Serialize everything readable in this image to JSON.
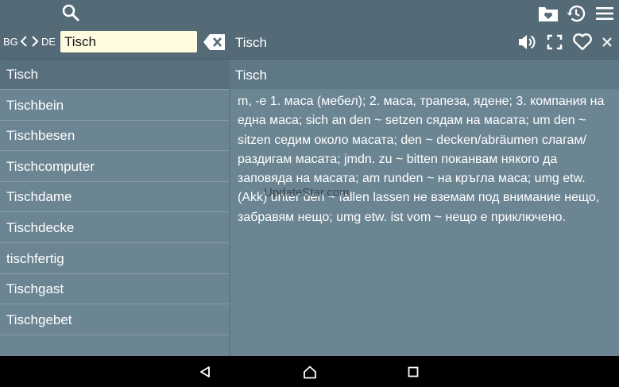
{
  "toolbar": {
    "search_icon": "search-icon",
    "favorites_icon": "favorites-folder-icon",
    "history_icon": "history-icon",
    "menu_icon": "menu-icon"
  },
  "search": {
    "source_lang": "BG",
    "target_lang": "DE",
    "query": "Tisch",
    "clear_icon": "backspace-clear-icon"
  },
  "detail_header": {
    "word": "Tisch",
    "icons": [
      "speaker-icon",
      "fullscreen-icon",
      "heart-icon",
      "close-icon"
    ]
  },
  "word_list": [
    {
      "label": "Tisch",
      "selected": true
    },
    {
      "label": "Tischbein",
      "selected": false
    },
    {
      "label": "Tischbesen",
      "selected": false
    },
    {
      "label": "Tischcomputer",
      "selected": false
    },
    {
      "label": "Tischdame",
      "selected": false
    },
    {
      "label": "Tischdecke",
      "selected": false
    },
    {
      "label": "tischfertig",
      "selected": false
    },
    {
      "label": "Tischgast",
      "selected": false
    },
    {
      "label": "Tischgebet",
      "selected": false
    }
  ],
  "entry": {
    "title": "Tisch",
    "definition": "m, -e 1. маса (мебел); 2. маса, трапеза, ядене; 3. компания на една маса; sich an den ~ setzen сядам на масата; um den ~ sitzen седим около масата; den ~ decken/abräumen слагам/раздигам масата; jmdn. zu ~ bitten поканвам някого да заповяда на масата; am runden ~ на кръгла маса; umg etw. (Akk) unter den ~ fallen lassen не вземам под внимание нещо, забравям нещо; umg etw. ist vom ~ нещо е приключено."
  },
  "watermark": "UpdateStar.com",
  "navbar": {
    "icons": [
      "back-icon",
      "home-icon",
      "recents-icon"
    ]
  },
  "colors": {
    "bar": "#546a77",
    "content": "#6b8593",
    "selected": "#586f7d",
    "input_bg": "#fffbe1",
    "nav": "#000000"
  }
}
